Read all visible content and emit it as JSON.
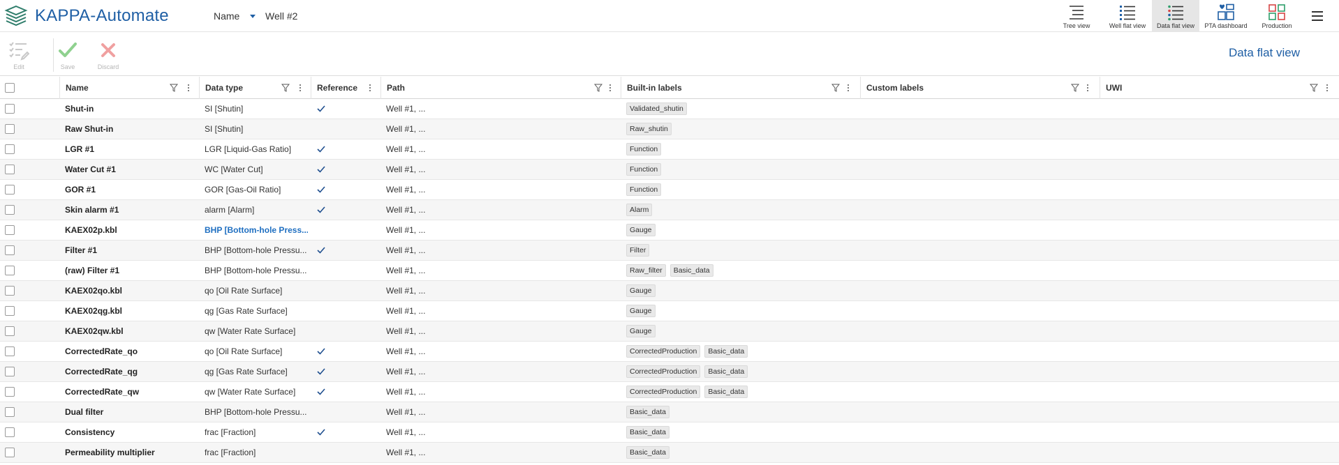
{
  "app": {
    "title": "KAPPA-Automate"
  },
  "nav": {
    "name_label": "Name",
    "well_label": "Well #2"
  },
  "views": [
    {
      "label": "Tree view",
      "icon": "tree-view-icon",
      "active": false
    },
    {
      "label": "Well flat view",
      "icon": "well-flat-view-icon",
      "active": false
    },
    {
      "label": "Data flat view",
      "icon": "data-flat-view-icon",
      "active": true
    },
    {
      "label": "PTA dashboard",
      "icon": "pta-dashboard-icon",
      "active": false
    },
    {
      "label": "Production",
      "icon": "production-icon",
      "active": false
    }
  ],
  "toolbar": {
    "edit_label": "Edit",
    "save_label": "Save",
    "discard_label": "Discard",
    "view_title": "Data flat view"
  },
  "colors": {
    "brand": "#1f5fa5",
    "link": "#1f6fc1",
    "save_green": "#7bc47f",
    "discard_red": "#e57373"
  },
  "columns": [
    {
      "label": "Name"
    },
    {
      "label": "Data type"
    },
    {
      "label": "Reference"
    },
    {
      "label": "Path"
    },
    {
      "label": "Built-in labels"
    },
    {
      "label": "Custom labels"
    },
    {
      "label": "UWI"
    }
  ],
  "rows": [
    {
      "name": "Shut-in",
      "type": "SI [Shutin]",
      "reference": true,
      "path": "Well #1, ...",
      "labels": [
        "Validated_shutin"
      ]
    },
    {
      "name": "Raw Shut-in",
      "type": "SI [Shutin]",
      "reference": false,
      "path": "Well #1, ...",
      "labels": [
        "Raw_shutin"
      ]
    },
    {
      "name": "LGR #1",
      "type": "LGR [Liquid-Gas Ratio]",
      "reference": true,
      "path": "Well #1, ...",
      "labels": [
        "Function"
      ]
    },
    {
      "name": "Water Cut #1",
      "type": "WC [Water Cut]",
      "reference": true,
      "path": "Well #1, ...",
      "labels": [
        "Function"
      ]
    },
    {
      "name": "GOR #1",
      "type": "GOR [Gas-Oil Ratio]",
      "reference": true,
      "path": "Well #1, ...",
      "labels": [
        "Function"
      ]
    },
    {
      "name": "Skin alarm #1",
      "type": "alarm [Alarm]",
      "reference": true,
      "path": "Well #1, ...",
      "labels": [
        "Alarm"
      ]
    },
    {
      "name": "KAEX02p.kbl",
      "type": "BHP [Bottom-hole Press...",
      "type_link": true,
      "reference": false,
      "path": "Well #1, ...",
      "labels": [
        "Gauge"
      ]
    },
    {
      "name": "Filter #1",
      "type": "BHP [Bottom-hole Pressu...",
      "reference": true,
      "path": "Well #1, ...",
      "labels": [
        "Filter"
      ]
    },
    {
      "name": "(raw) Filter #1",
      "type": "BHP [Bottom-hole Pressu...",
      "reference": false,
      "path": "Well #1, ...",
      "labels": [
        "Raw_filter",
        "Basic_data"
      ]
    },
    {
      "name": "KAEX02qo.kbl",
      "type": "qo [Oil Rate Surface]",
      "reference": false,
      "path": "Well #1, ...",
      "labels": [
        "Gauge"
      ]
    },
    {
      "name": "KAEX02qg.kbl",
      "type": "qg [Gas Rate Surface]",
      "reference": false,
      "path": "Well #1, ...",
      "labels": [
        "Gauge"
      ]
    },
    {
      "name": "KAEX02qw.kbl",
      "type": "qw [Water Rate Surface]",
      "reference": false,
      "path": "Well #1, ...",
      "labels": [
        "Gauge"
      ]
    },
    {
      "name": "CorrectedRate_qo",
      "type": "qo [Oil Rate Surface]",
      "reference": true,
      "path": "Well #1, ...",
      "labels": [
        "CorrectedProduction",
        "Basic_data"
      ]
    },
    {
      "name": "CorrectedRate_qg",
      "type": "qg [Gas Rate Surface]",
      "reference": true,
      "path": "Well #1, ...",
      "labels": [
        "CorrectedProduction",
        "Basic_data"
      ]
    },
    {
      "name": "CorrectedRate_qw",
      "type": "qw [Water Rate Surface]",
      "reference": true,
      "path": "Well #1, ...",
      "labels": [
        "CorrectedProduction",
        "Basic_data"
      ]
    },
    {
      "name": "Dual filter",
      "type": "BHP [Bottom-hole Pressu...",
      "reference": false,
      "path": "Well #1, ...",
      "labels": [
        "Basic_data"
      ]
    },
    {
      "name": "Consistency",
      "type": "frac [Fraction]",
      "reference": true,
      "path": "Well #1, ...",
      "labels": [
        "Basic_data"
      ]
    },
    {
      "name": "Permeability multiplier",
      "type": "frac [Fraction]",
      "reference": false,
      "path": "Well #1, ...",
      "labels": [
        "Basic_data"
      ]
    }
  ]
}
